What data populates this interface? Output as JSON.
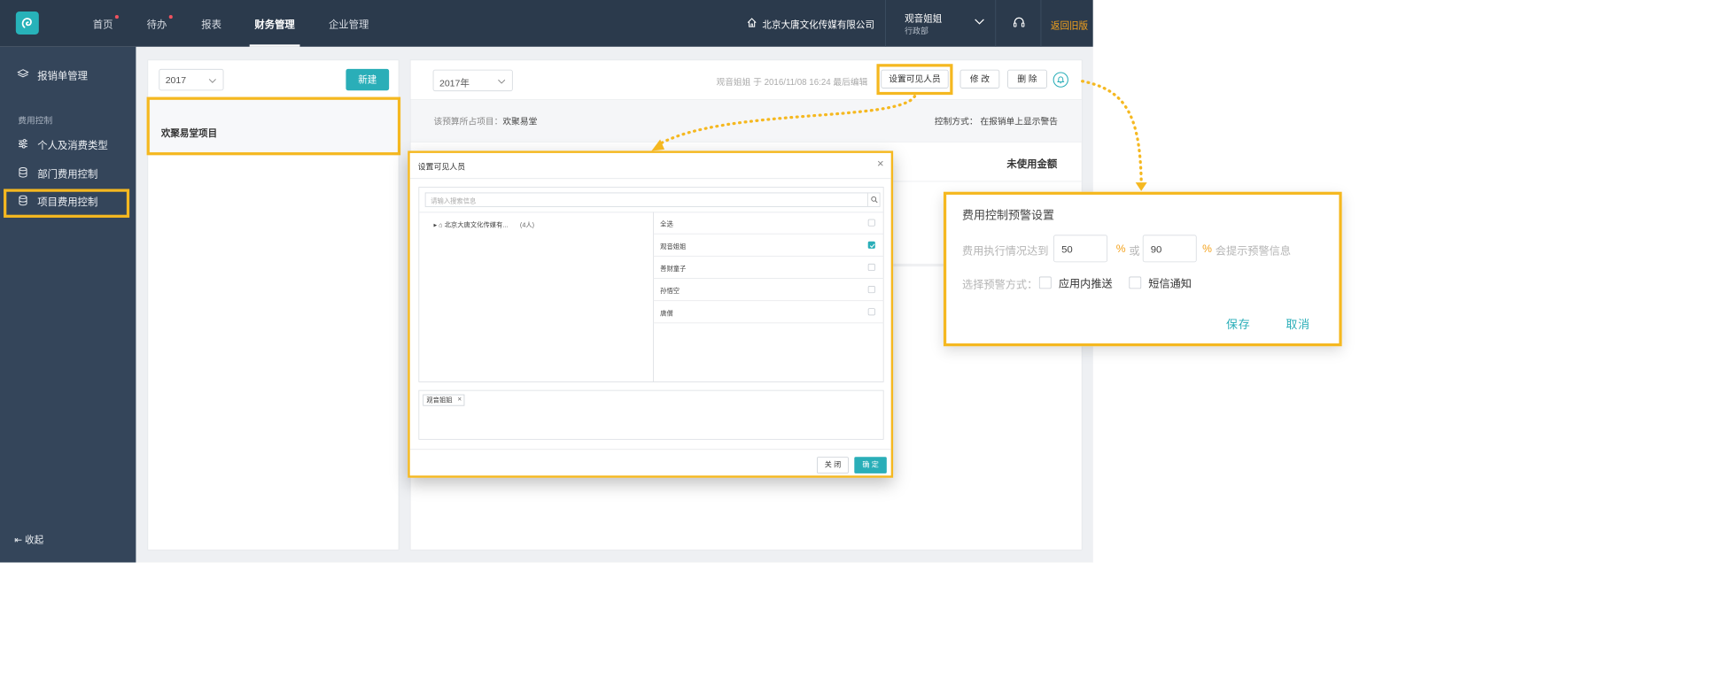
{
  "topbar": {
    "nav": [
      "首页",
      "待办",
      "报表",
      "财务管理",
      "企业管理"
    ],
    "company": "北京大唐文化传媒有限公司",
    "user_name": "观音姐姐",
    "user_dept": "行政部",
    "back_old": "返回旧版"
  },
  "sidebar": {
    "items": [
      "报销单管理",
      "个人及消费类型",
      "部门费用控制",
      "项目费用控制"
    ],
    "section": "费用控制",
    "collapse": "收起"
  },
  "left_panel": {
    "year": "2017",
    "new_label": "新建",
    "project": "欢聚易堂项目"
  },
  "right_panel": {
    "year": "2017年",
    "meta": "观音姐姐 于 2016/11/08 16:24 最后编辑",
    "btn_visible": "设置可见人员",
    "btn_edit": "修 改",
    "btn_delete": "删 除",
    "info_label": "该预算所占项目：",
    "info_value": "欢聚易堂",
    "control_mode": "控制方式： 在报销单上显示警告",
    "unused": "未使用金额"
  },
  "modal": {
    "title": "设置可见人员",
    "close": "×",
    "search_placeholder": "请输入搜索信息",
    "tree_org": "北京大唐文化传媒有...",
    "tree_count": "(4人)",
    "people": [
      {
        "name": "全选",
        "checked": false
      },
      {
        "name": "观音姐姐",
        "checked": true
      },
      {
        "name": "善财童子",
        "checked": false
      },
      {
        "name": "孙悟空",
        "checked": false
      },
      {
        "name": "唐僧",
        "checked": false
      }
    ],
    "selected_tag": "观音姐姐",
    "tag_remove": "×",
    "btn_close": "关 闭",
    "btn_ok": "确 定"
  },
  "popup": {
    "title": "费用控制预警设置",
    "line1_prefix": "费用执行情况达到",
    "value1": "50",
    "pct": "%",
    "or": "或",
    "value2": "90",
    "line1_suffix": "会提示预警信息",
    "line2_label": "选择预警方式：",
    "opt_inapp": "应用内推送",
    "opt_sms": "短信通知",
    "save": "保存",
    "cancel": "取消"
  },
  "colors": {
    "topbar": "#2b3a4c",
    "sidebar": "#34455a",
    "accent": "#2aaeb8",
    "highlight": "#f5b820",
    "back_old": "#f4a21c"
  }
}
